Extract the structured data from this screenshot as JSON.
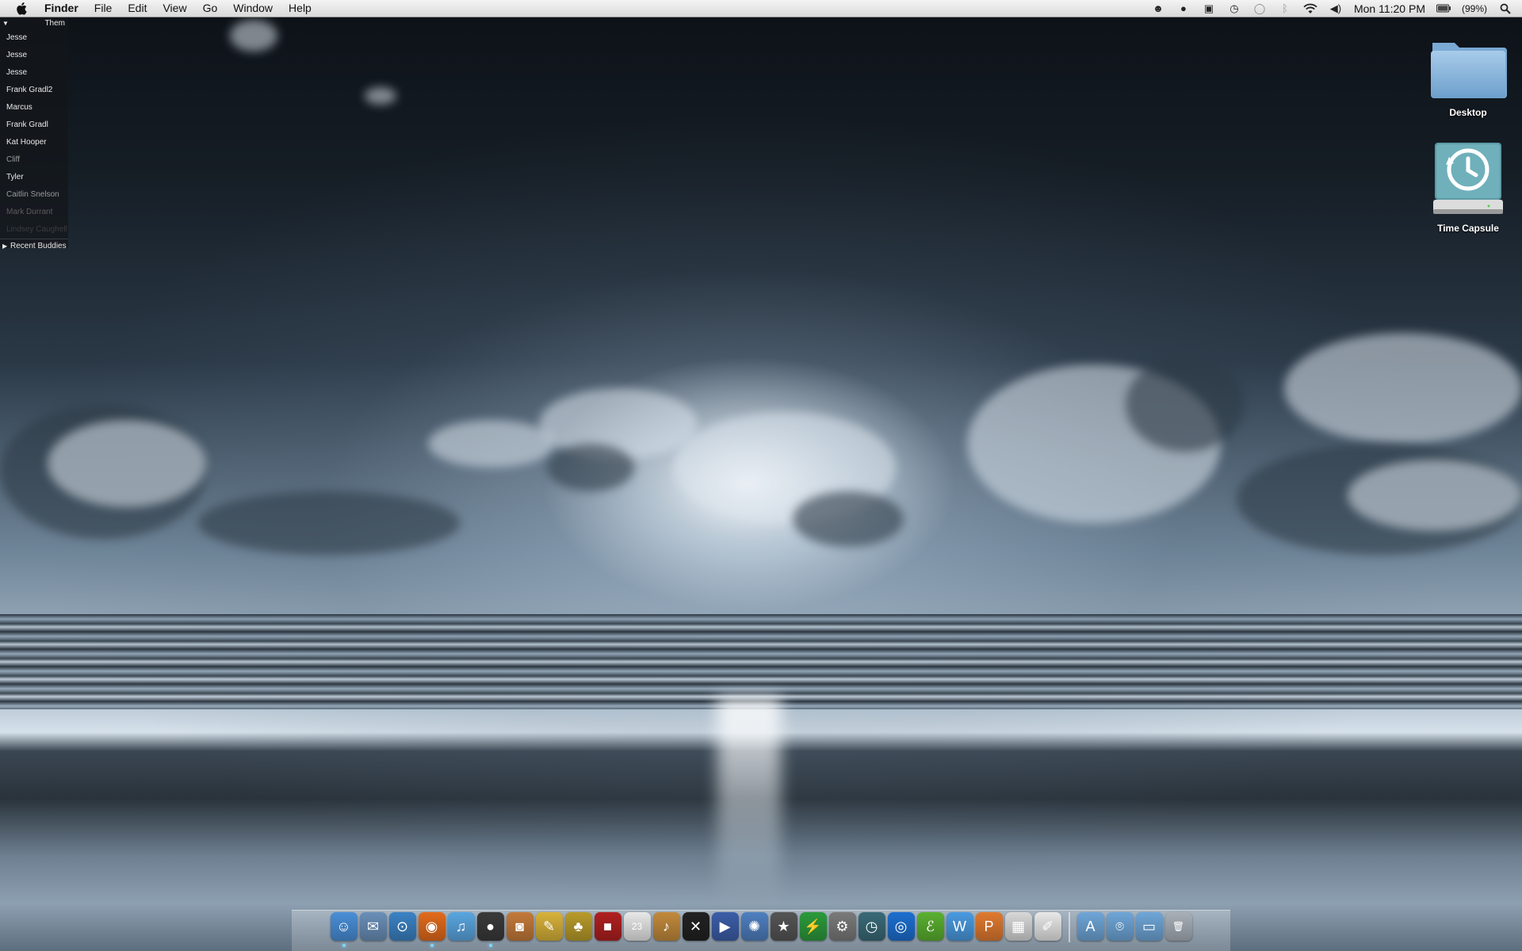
{
  "menubar": {
    "app_name": "Finder",
    "menus": [
      "File",
      "Edit",
      "View",
      "Go",
      "Window",
      "Help"
    ],
    "clock": "Mon 11:20 PM",
    "battery": "(99%)",
    "status_icons": [
      "skype-icon",
      "record-icon",
      "adium-icon",
      "time-machine-icon",
      "chat-icon",
      "bluetooth-icon",
      "wifi-icon",
      "volume-icon",
      "battery-icon",
      "spotlight-icon"
    ]
  },
  "buddy_list": {
    "group_label": "Them",
    "buddies": [
      {
        "name": "Jesse",
        "status": "online"
      },
      {
        "name": "Jesse",
        "status": "online"
      },
      {
        "name": "Jesse",
        "status": "online"
      },
      {
        "name": "Frank Gradl2",
        "status": "online"
      },
      {
        "name": "Marcus",
        "status": "online"
      },
      {
        "name": "Frank Gradl",
        "status": "online"
      },
      {
        "name": "Kat Hooper",
        "status": "online"
      },
      {
        "name": "Cliff",
        "status": "idle"
      },
      {
        "name": "Tyler",
        "status": "online"
      },
      {
        "name": "Caitlin Snelson",
        "status": "idle"
      },
      {
        "name": "Mark Durrant",
        "status": "away"
      },
      {
        "name": "Lindsey Caughell",
        "status": "off"
      }
    ],
    "recent_label": "Recent Buddies"
  },
  "desktop_icons": [
    {
      "label": "Desktop",
      "icon": "folder-icon"
    },
    {
      "label": "Time Capsule",
      "icon": "time-capsule-icon"
    }
  ],
  "dock": {
    "apps": [
      {
        "icon": "finder-icon",
        "color": "#4a8fd8",
        "glyph": "☺",
        "running": true
      },
      {
        "icon": "mail-stamp-icon",
        "color": "#6a8fb8",
        "glyph": "✉",
        "running": false
      },
      {
        "icon": "safari-icon",
        "color": "#3b82c4",
        "glyph": "⊙",
        "running": false
      },
      {
        "icon": "firefox-icon",
        "color": "#e26b1c",
        "glyph": "◉",
        "running": true
      },
      {
        "icon": "itunes-icon",
        "color": "#5aa6e0",
        "glyph": "♫",
        "running": false
      },
      {
        "icon": "adium-icon",
        "color": "#3a3a3a",
        "glyph": "●",
        "running": true
      },
      {
        "icon": "iphoto-icon",
        "color": "#c47a3a",
        "glyph": "◙",
        "running": false
      },
      {
        "icon": "pencil-icon",
        "color": "#d8b23a",
        "glyph": "✎",
        "running": false
      },
      {
        "icon": "pineapple-icon",
        "color": "#b89b2a",
        "glyph": "♣",
        "running": false
      },
      {
        "icon": "red-app-icon",
        "color": "#b02020",
        "glyph": "■",
        "running": false
      },
      {
        "icon": "ical-icon",
        "color": "#e8e8e8",
        "glyph": "23",
        "running": false
      },
      {
        "icon": "garageband-icon",
        "color": "#c28a3c",
        "glyph": "♪",
        "running": false
      },
      {
        "icon": "x-app-icon",
        "color": "#222222",
        "glyph": "✕",
        "running": false
      },
      {
        "icon": "imovie-icon",
        "color": "#3c5ea8",
        "glyph": "▶",
        "running": false
      },
      {
        "icon": "swirl-app-icon",
        "color": "#4f7fc0",
        "glyph": "✺",
        "running": false
      },
      {
        "icon": "star-app-icon",
        "color": "#555555",
        "glyph": "★",
        "running": false
      },
      {
        "icon": "instruments-icon",
        "color": "#2c9a3c",
        "glyph": "⚡",
        "running": false
      },
      {
        "icon": "system-preferences-icon",
        "color": "#7a7a7a",
        "glyph": "⚙",
        "running": false
      },
      {
        "icon": "time-machine-icon",
        "color": "#3a6a78",
        "glyph": "◷",
        "running": false
      },
      {
        "icon": "dvd-player-icon",
        "color": "#1d6fd0",
        "glyph": "◎",
        "running": false
      },
      {
        "icon": "green-bird-icon",
        "color": "#5ab030",
        "glyph": "ℰ",
        "running": false
      },
      {
        "icon": "word-icon",
        "color": "#4a9ae0",
        "glyph": "W",
        "running": false
      },
      {
        "icon": "powerpoint-icon",
        "color": "#e07a30",
        "glyph": "P",
        "running": false
      },
      {
        "icon": "spreadsheet-icon",
        "color": "#d8d8d8",
        "glyph": "▦",
        "running": false
      },
      {
        "icon": "textedit-icon",
        "color": "#e8e8e8",
        "glyph": "✐",
        "running": false
      }
    ],
    "stacks": [
      {
        "icon": "applications-stack-icon",
        "color": "#6fa6d8",
        "glyph": "A"
      },
      {
        "icon": "downloads-stack-icon",
        "color": "#6fa6d8",
        "glyph": "⌾"
      },
      {
        "icon": "documents-stack-icon",
        "color": "#6fa6d8",
        "glyph": "▭"
      },
      {
        "icon": "trash-icon",
        "color": "#a8b0b8",
        "glyph": "🗑"
      }
    ]
  }
}
